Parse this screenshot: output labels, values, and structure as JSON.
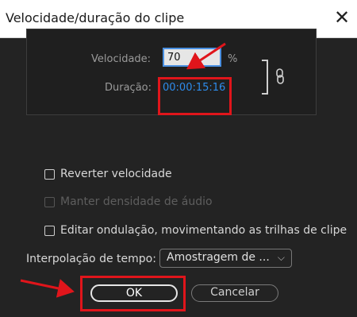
{
  "window": {
    "title": "Velocidade/duração do clipe",
    "close_glyph": "✕"
  },
  "speed": {
    "label": "Velocidade:",
    "value": "70",
    "unit": "%"
  },
  "duration": {
    "label": "Duração:",
    "value": "00:00:15:16"
  },
  "options": [
    {
      "label": "Reverter velocidade",
      "checked": false,
      "enabled": true
    },
    {
      "label": "Manter densidade de áudio",
      "checked": false,
      "enabled": false
    },
    {
      "label": "Editar ondulação, movimentando as trilhas de clipe",
      "checked": false,
      "enabled": true
    }
  ],
  "interpolation": {
    "label": "Interpolação de tempo:",
    "selected": "Amostragem de ..."
  },
  "buttons": {
    "ok": "OK",
    "cancel": "Cancelar"
  },
  "colors": {
    "dialog_bg": "#232323",
    "accent_blue": "#2d8ceb",
    "annotation_red": "#e0151b"
  },
  "icons": {
    "link": "link-chain-icon",
    "close": "close-icon",
    "dropdown": "chevron-down-icon"
  }
}
